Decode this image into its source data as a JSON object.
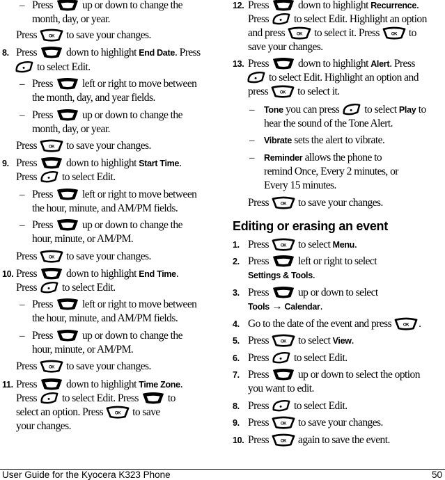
{
  "left_column": {
    "top_sub_step": {
      "pre": "Press",
      "post": "up or down to change the",
      "cont": "month, day, or year."
    },
    "top_save": {
      "pre": "Press",
      "post": "to save your changes."
    },
    "step8": {
      "num": "8.",
      "pre": "Press",
      "mid": "down to highlight",
      "bold": "End Date",
      "tail": ". Press",
      "line2": "to select Edit.",
      "sub1": {
        "pre": "Press",
        "post": "left or right to move between",
        "cont": "the month, day, and year fields."
      },
      "sub2": {
        "pre": "Press",
        "post": "up or down to change the",
        "cont": "month, day, or year."
      },
      "save": {
        "pre": "Press",
        "post": "to save your changes."
      }
    },
    "step9": {
      "num": "9.",
      "pre": "Press",
      "mid": "down to highlight",
      "bold": "Start Time",
      "tail": ".",
      "line2pre": "Press",
      "line2": "to select Edit.",
      "sub1": {
        "pre": "Press",
        "post": "left or right to move between",
        "cont": "the hour, minute, and AM/PM fields."
      },
      "sub2": {
        "pre": "Press",
        "post": "up or down to change the",
        "cont": "hour, minute, or AM/PM."
      },
      "save": {
        "pre": "Press",
        "post": "to save your changes."
      }
    },
    "step10": {
      "num": "10.",
      "pre": "Press",
      "mid": "down to highlight",
      "bold": "End Time",
      "tail": ".",
      "line2pre": "Press",
      "line2": "to select Edit.",
      "sub1": {
        "pre": "Press",
        "post": "left or right to move between",
        "cont": "the hour, minute, and AM/PM fields."
      },
      "sub2": {
        "pre": "Press",
        "post": "up or down to change the",
        "cont": "hour, minute, or AM/PM."
      },
      "save": {
        "pre": "Press",
        "post": "to save your changes."
      }
    },
    "step11": {
      "num": "11.",
      "pre": "Press",
      "mid": "down to highlight",
      "bold": "Time Zone",
      "tail": ".",
      "line2pre": "Press",
      "line2mid": "to select Edit. Press",
      "line2post": "to",
      "line3pre": "select an option. Press",
      "line3post": "to save",
      "line4": "your changes."
    }
  },
  "right_column": {
    "step12": {
      "num": "12.",
      "pre": "Press",
      "mid": "down to highlight",
      "bold": "Recurrence",
      "tail": ".",
      "line2pre": "Press",
      "line2post": "to select Edit. Highlight an option",
      "line3pre": "and press",
      "line3mid": "to select it. Press",
      "line3post": "to",
      "line4": "save your changes."
    },
    "step13": {
      "num": "13.",
      "pre": "Press",
      "mid": "down to highlight",
      "bold": "Alert",
      "tail": ". Press",
      "line2post": "to select Edit. Highlight an option and",
      "line3pre": "press",
      "line3post": "to select it.",
      "tone": {
        "bold": "Tone",
        "mid": "you can press",
        "post": "to select",
        "bold2": "Play",
        "tail": "to",
        "cont": "hear the sound of the Tone Alert."
      },
      "vibrate": {
        "bold": "Vibrate",
        "post": "sets the alert to vibrate."
      },
      "reminder": {
        "bold": "Reminder",
        "post": "allows the phone to",
        "cont1": "remind Once, Every 2 minutes, or",
        "cont2": "Every 15 minutes."
      },
      "save": {
        "pre": "Press",
        "post": "to save your changes."
      }
    },
    "section_heading": "Editing or erasing an event",
    "edit_steps": [
      {
        "num": "1.",
        "pre": "Press",
        "post": "to select",
        "bold": "Menu",
        "tail": "."
      },
      {
        "num": "2.",
        "pre": "Press",
        "post": "left or right to select",
        "bold": "Settings & Tools",
        "tail": "."
      },
      {
        "num": "3.",
        "pre": "Press",
        "post": "up or down to select",
        "bold": "Tools",
        "arrow": "→",
        "bold2": "Calendar",
        "tail": "."
      },
      {
        "num": "4.",
        "pre": "Go to the date of the event and press",
        "tail": "."
      },
      {
        "num": "5.",
        "pre": "Press",
        "post": "to select",
        "bold": "View",
        "tail": "."
      },
      {
        "num": "6.",
        "pre": "Press",
        "post": "to select Edit."
      },
      {
        "num": "7.",
        "pre": "Press",
        "post": "up or down to select the option",
        "cont": "you want to edit."
      },
      {
        "num": "8.",
        "pre": "Press",
        "post": "to select Edit."
      },
      {
        "num": "9.",
        "pre": "Press",
        "post": "to save your changes."
      },
      {
        "num": "10.",
        "pre": "Press",
        "post": "again to save the event."
      }
    ]
  },
  "icons": {
    "ok_label": "OK"
  },
  "footer": {
    "title": "User Guide for the Kyocera K323 Phone",
    "page": "50"
  }
}
